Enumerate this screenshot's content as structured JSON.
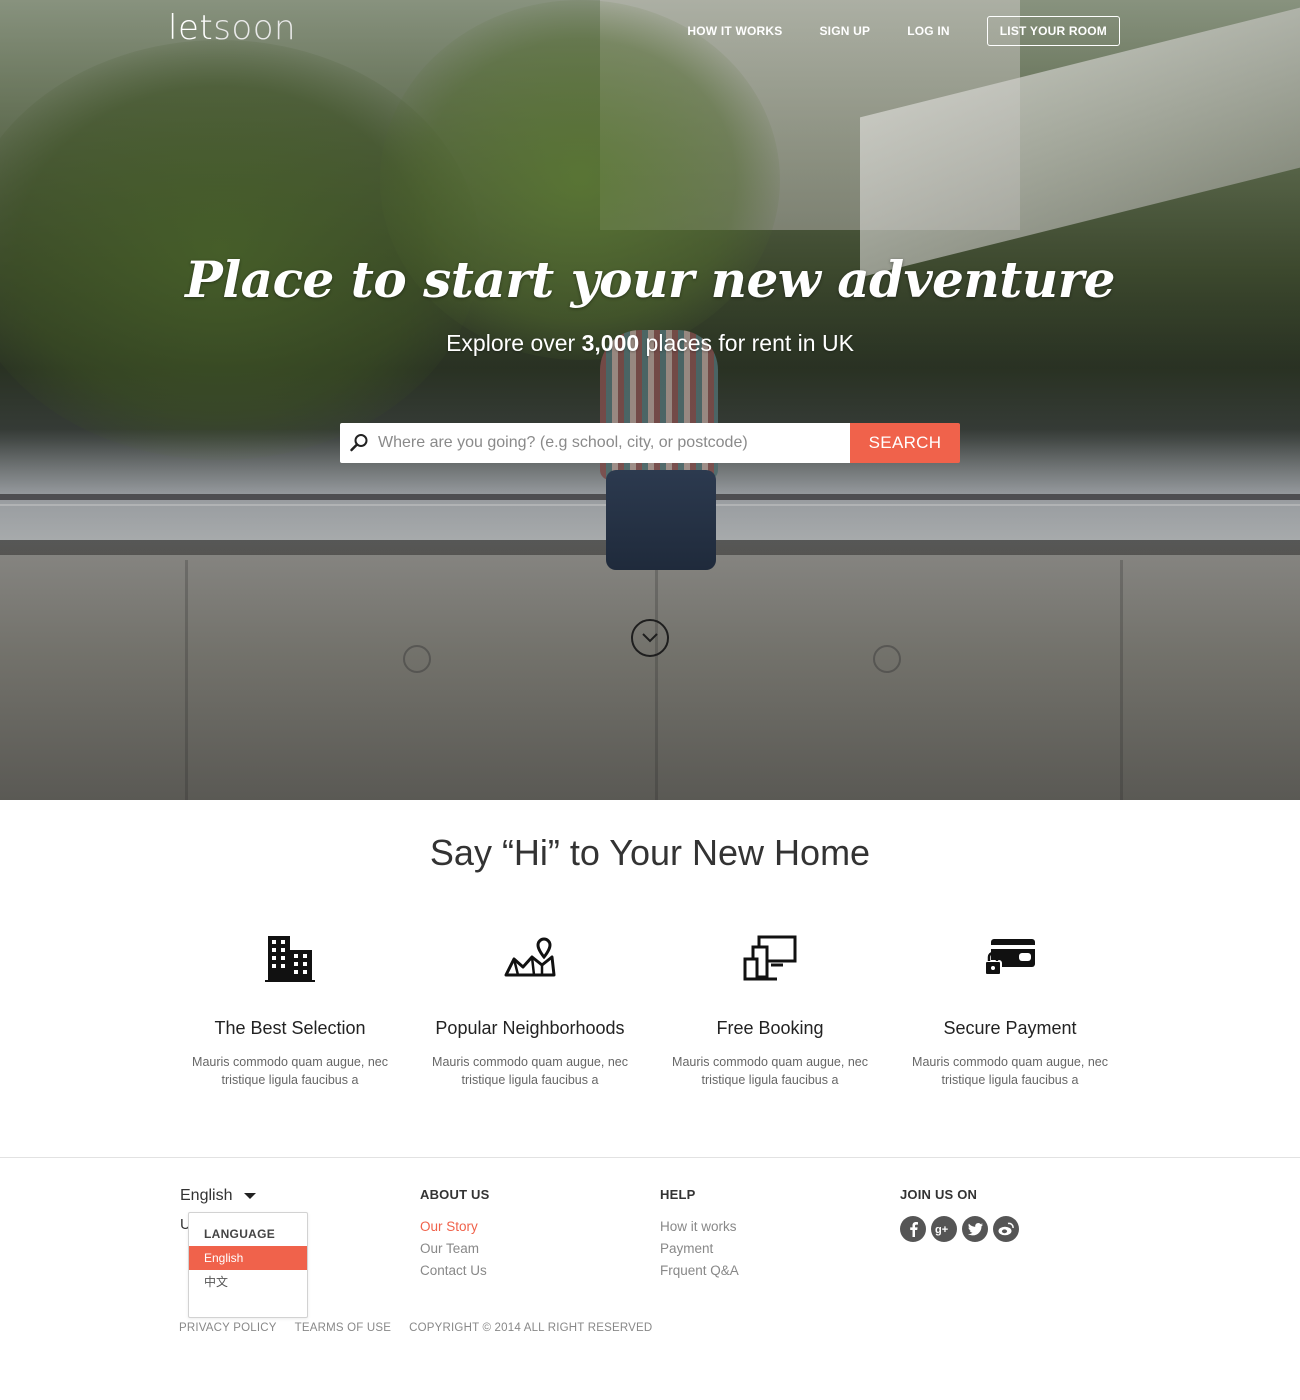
{
  "brand": {
    "logo_bold": "let",
    "logo_light": "soon"
  },
  "nav": {
    "how_it_works": "HOW IT WORKS",
    "sign_up": "SIGN UP",
    "log_in": "LOG IN",
    "list_room": "LIST YOUR ROOM"
  },
  "hero": {
    "title": "Place to start your new adventure",
    "subtitle_before": "Explore over ",
    "subtitle_count": "3,000",
    "subtitle_after": " places for rent in UK",
    "search_placeholder": "Where are you going? (e.g school, city, or postcode)",
    "search_button": "SEARCH"
  },
  "features": {
    "title": "Say “Hi” to Your New Home",
    "items": [
      {
        "icon": "building-icon",
        "title": "The Best Selection",
        "text": "Mauris commodo quam augue, nec tristique ligula faucibus a"
      },
      {
        "icon": "map-pin-icon",
        "title": "Popular Neighborhoods",
        "text": "Mauris commodo quam augue, nec tristique ligula faucibus a"
      },
      {
        "icon": "devices-icon",
        "title": "Free Booking",
        "text": "Mauris commodo quam augue, nec tristique ligula faucibus a"
      },
      {
        "icon": "secure-card-icon",
        "title": "Secure Payment",
        "text": "Mauris commodo quam augue, nec tristique ligula faucibus a"
      }
    ]
  },
  "footer": {
    "language": {
      "selected": "English",
      "peek": "U",
      "dropdown_header": "LANGUAGE",
      "options": [
        "English",
        "中文"
      ]
    },
    "about": {
      "title": "ABOUT US",
      "links": [
        "Our Story",
        "Our Team",
        "Contact Us"
      ]
    },
    "help": {
      "title": "HELP",
      "links": [
        "How it works",
        "Payment",
        "Frquent Q&A"
      ]
    },
    "join": {
      "title": "JOIN US ON",
      "social": [
        "facebook-icon",
        "google-plus-icon",
        "twitter-icon",
        "weibo-icon"
      ]
    },
    "bottom": {
      "privacy": "PRIVACY POLICY",
      "terms": "TEARMS OF USE",
      "copyright": "COPYRIGHT © 2014  ALL RIGHT RESERVED"
    }
  },
  "colors": {
    "accent": "#f0624b",
    "text": "#333333",
    "muted": "#888888"
  }
}
